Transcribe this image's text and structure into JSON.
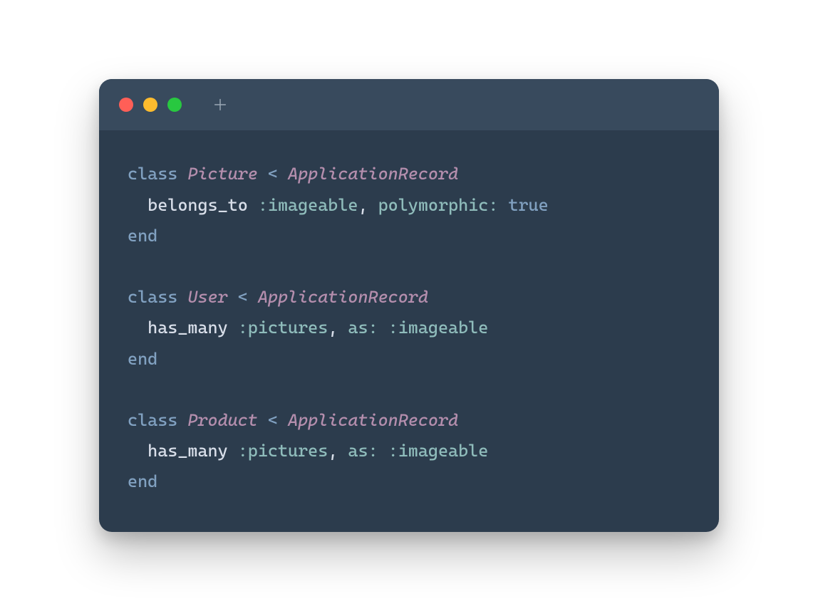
{
  "window": {
    "traffic_lights": {
      "close_color": "#ff5f57",
      "minimize_color": "#febc2e",
      "zoom_color": "#28c840"
    },
    "new_tab_icon": "plus-icon"
  },
  "code": {
    "line1": {
      "kw_class": "class",
      "class_name": "Picture",
      "lt": "<",
      "parent": "ApplicationRecord"
    },
    "line2": {
      "indent": "  ",
      "method": "belongs_to",
      "arg1": ":imageable",
      "comma": ", ",
      "kwarg": "polymorphic:",
      "val": "true"
    },
    "line3": {
      "kw_end": "end"
    },
    "line4": "",
    "line5": {
      "kw_class": "class",
      "class_name": "User",
      "lt": "<",
      "parent": "ApplicationRecord"
    },
    "line6": {
      "indent": "  ",
      "method": "has_many",
      "arg1": ":pictures",
      "comma": ", ",
      "kwarg": "as:",
      "val": ":imageable"
    },
    "line7": {
      "kw_end": "end"
    },
    "line8": "",
    "line9": {
      "kw_class": "class",
      "class_name": "Product",
      "lt": "<",
      "parent": "ApplicationRecord"
    },
    "line10": {
      "indent": "  ",
      "method": "has_many",
      "arg1": ":pictures",
      "comma": ", ",
      "kwarg": "as:",
      "val": ":imageable"
    },
    "line11": {
      "kw_end": "end"
    }
  }
}
